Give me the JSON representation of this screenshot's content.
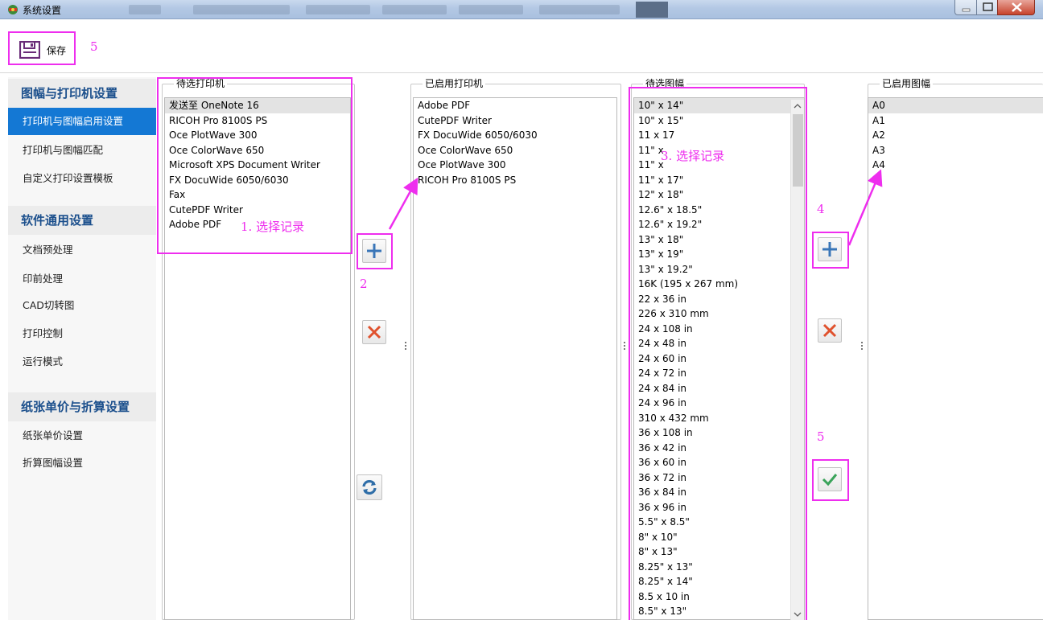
{
  "window": {
    "title": "系统设置"
  },
  "toolbar": {
    "save_label": "保存"
  },
  "annotations": {
    "save": "5",
    "select_printer": "1. 选择记录",
    "add_printer": "2",
    "select_size": "3. 选择记录",
    "add_size": "4",
    "confirm": "5"
  },
  "sidebar": {
    "sections": [
      {
        "title": "图幅与打印机设置",
        "items": [
          "打印机与图幅启用设置",
          "打印机与图幅匹配",
          "自定义打印设置模板"
        ]
      },
      {
        "title": "软件通用设置",
        "items": [
          "文档预处理",
          "印前处理",
          "CAD切转图",
          "打印控制",
          "运行模式"
        ]
      },
      {
        "title": "纸张单价与折算设置",
        "items": [
          "纸张单价设置",
          "折算图幅设置"
        ]
      }
    ],
    "active_item": "打印机与图幅启用设置"
  },
  "candidate_printers": {
    "title": "待选打印机",
    "items": [
      "发送至 OneNote 16",
      "RICOH Pro 8100S PS",
      "Oce PlotWave 300",
      "Oce ColorWave 650",
      "Microsoft XPS Document Writer",
      "FX DocuWide 6050/6030",
      "Fax",
      "CutePDF Writer",
      "Adobe PDF"
    ],
    "selected_index": 0
  },
  "enabled_printers": {
    "title": "已启用打印机",
    "items": [
      "Adobe PDF",
      "CutePDF Writer",
      "FX DocuWide 6050/6030",
      "Oce ColorWave 650",
      "Oce PlotWave 300",
      "RICOH Pro 8100S PS"
    ]
  },
  "candidate_sizes": {
    "title": "待选图幅",
    "items": [
      "10\" x 14\"",
      "10\" x 15\"",
      "11 x 17",
      "11\" x",
      "11\" x",
      "11\" x 17\"",
      "12\" x 18\"",
      "12.6\" x 18.5\"",
      "12.6\" x 19.2\"",
      "13\" x 18\"",
      "13\" x 19\"",
      "13\" x 19.2\"",
      "16K (195 x 267 mm)",
      "22 x 36 in",
      "226 x 310 mm",
      "24 x 108 in",
      "24 x 48 in",
      "24 x 60 in",
      "24 x 72 in",
      "24 x 84 in",
      "24 x 96 in",
      "310 x 432 mm",
      "36 x 108 in",
      "36 x 42 in",
      "36 x 60 in",
      "36 x 72 in",
      "36 x 84 in",
      "36 x 96 in",
      "5.5\" x 8.5\"",
      "8\" x 10\"",
      "8\" x 13\"",
      "8.25\" x 13\"",
      "8.25\" x 14\"",
      "8.5 x 10 in",
      "8.5\" x 13\""
    ],
    "selected_index": 0
  },
  "enabled_sizes": {
    "title": "已启用图幅",
    "items": [
      "A0",
      "A1",
      "A2",
      "A3",
      "A4"
    ],
    "selected_index": 0
  },
  "colors": {
    "accent": "#1478d4",
    "annotation": "#ee2eee",
    "section_title": "#1b4f8c",
    "add_icon": "#3a76b8",
    "remove_icon": "#e0522e",
    "confirm_icon": "#3aa35a"
  }
}
